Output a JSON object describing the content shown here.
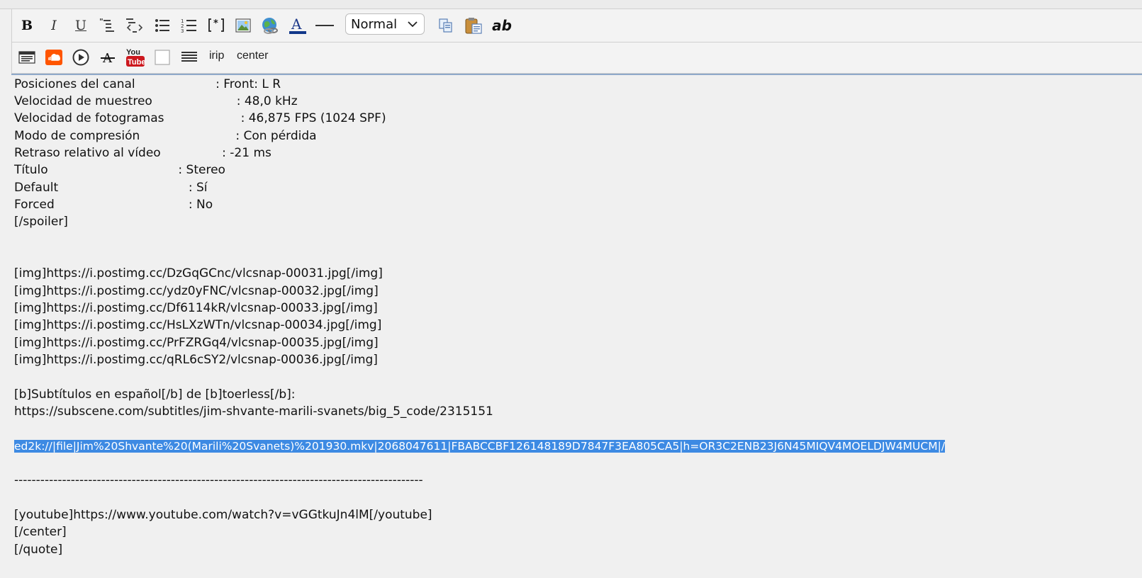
{
  "toolbar": {
    "bold_label": "B",
    "italic_label": "I",
    "underline_label": "U",
    "format_select": {
      "selected": "Normal"
    },
    "ab_label": "ab",
    "irip_label": "irip",
    "center_label": "center"
  },
  "icons": {
    "row1": [
      "bold-icon",
      "italic-icon",
      "underline-icon",
      "quote-icon",
      "code-icon",
      "bulleted-list-icon",
      "numbered-list-icon",
      "list-item-icon",
      "image-icon",
      "link-globe-icon",
      "font-color-icon",
      "horizontal-rule-icon",
      "copy-icon",
      "paste-icon",
      "spellcheck-icon"
    ],
    "row2": [
      "spoiler-icon",
      "soundcloud-icon",
      "play-icon",
      "strikethrough-icon",
      "youtube-icon",
      "blank-box-icon",
      "justify-icon"
    ]
  },
  "colors": {
    "selection": "#3d8ae3",
    "soundcloud": "#ff5500",
    "youtube": "#cc181e",
    "editor_bg": "#f0f0f0"
  },
  "editor": {
    "lines": [
      "Posiciones del canal                     : Front: L R",
      "Velocidad de muestreo                      : 48,0 kHz",
      "Velocidad de fotogramas                    : 46,875 FPS (1024 SPF)",
      "Modo de compresión                         : Con pérdida",
      "Retraso relativo al vídeo                : -21 ms",
      "Título                                  : Stereo",
      "Default                                  : Sí",
      "Forced                                   : No",
      "[/spoiler]",
      "",
      "",
      "[img]https://i.postimg.cc/DzGqGCnc/vlcsnap-00031.jpg[/img]",
      "[img]https://i.postimg.cc/ydz0yFNC/vlcsnap-00032.jpg[/img]",
      "[img]https://i.postimg.cc/Df6114kR/vlcsnap-00033.jpg[/img]",
      "[img]https://i.postimg.cc/HsLXzWTn/vlcsnap-00034.jpg[/img]",
      "[img]https://i.postimg.cc/PrFZRGq4/vlcsnap-00035.jpg[/img]",
      "[img]https://i.postimg.cc/qRL6cSY2/vlcsnap-00036.jpg[/img]",
      "",
      "[b]Subtítulos en español[/b] de [b]toerless[/b]:",
      "https://subscene.com/subtitles/jim-shvante-marili-svanets/big_5_code/2315151",
      "",
      "ed2k://|file|Jim%20Shvante%20(Marili%20Svanets)%201930.mkv|2068047611|FBABCCBF126148189D7847F3EA805CA5|h=OR3C2ENB23J6N45MIQV4MOELDJW4MUCM|/",
      "",
      "----------------------------------------------------------------------------------------------",
      "",
      "[youtube]https://www.youtube.com/watch?v=vGGtkuJn4lM[/youtube]",
      "[/center]",
      "[/quote]"
    ]
  }
}
